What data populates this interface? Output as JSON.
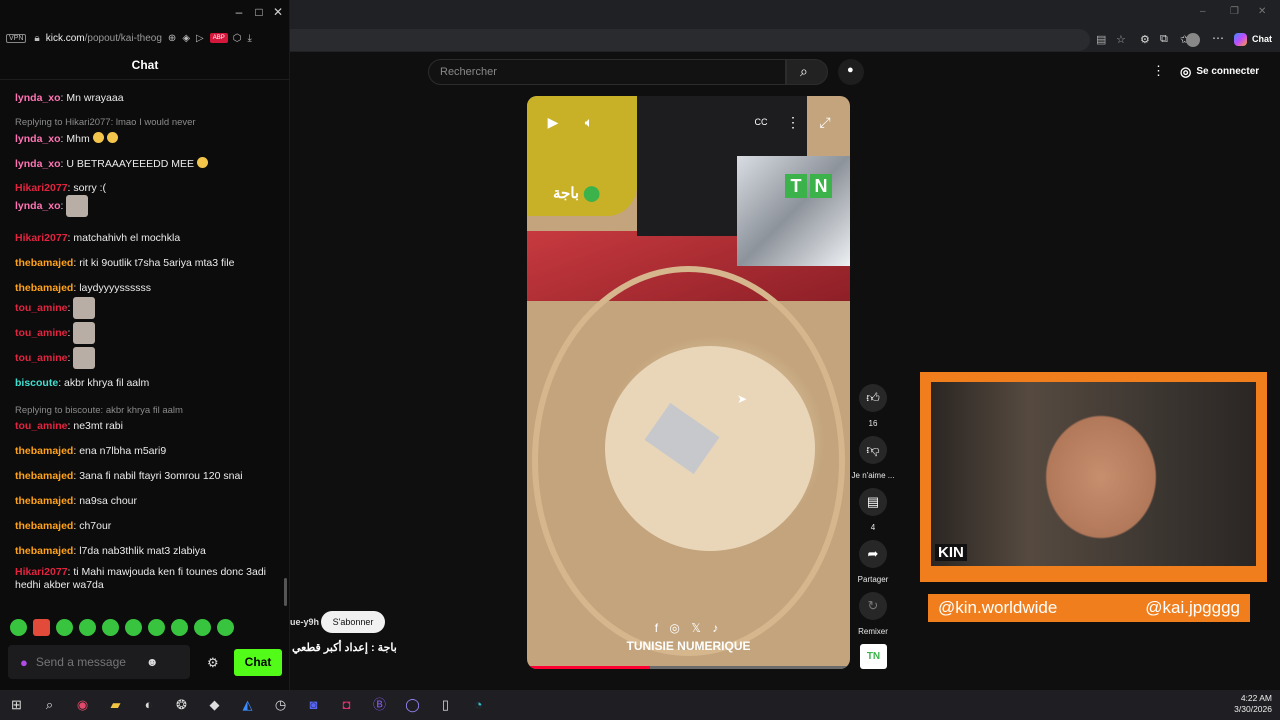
{
  "chat_window": {
    "url_host": "kick.com",
    "url_path": "/popout/kai-theog",
    "vpn_label": "VPN",
    "header_title": "Chat",
    "composer_placeholder": "Send a message",
    "send_label": "Chat"
  },
  "messages": [
    {
      "user": "lynda_xo",
      "text": "Mn wrayaaa",
      "color": "#ff74b3"
    },
    {
      "reply": "Replying to Hikari2077: lmao I would never"
    },
    {
      "user": "lynda_xo",
      "text": "Mhm",
      "color": "#ff74b3",
      "emojis": 2
    },
    {
      "user": "lynda_xo",
      "text": "U BETRAAAYEEEDD MEE",
      "color": "#ff74b3",
      "emojis": 1
    },
    {
      "user": "Hikari2077",
      "text": "sorry :(",
      "color": "#e2243f"
    },
    {
      "user": "lynda_xo",
      "text": "",
      "color": "#ff74b3",
      "emote": true
    },
    {
      "user": "Hikari2077",
      "text": "matchahivh el mochkla",
      "color": "#e2243f"
    },
    {
      "user": "thebamajed",
      "text": "rit ki 9outlik t7sha 5ariya mta3 file",
      "color": "#ffa21a"
    },
    {
      "user": "thebamajed",
      "text": "laydyyyyssssss",
      "color": "#ffa21a"
    },
    {
      "user": "tou_amine",
      "text": "",
      "color": "#e2243f",
      "emote": true
    },
    {
      "user": "tou_amine",
      "text": "",
      "color": "#e2243f",
      "emote": true
    },
    {
      "user": "tou_amine",
      "text": "",
      "color": "#e2243f",
      "emote": true
    },
    {
      "user": "biscoute",
      "text": "akbr khrya fil aalm",
      "color": "#40e0d0"
    },
    {
      "reply": "Replying to biscoute: akbr khrya fil aalm"
    },
    {
      "user": "tou_amine",
      "text": "ne3mt rabi",
      "color": "#e2243f"
    },
    {
      "user": "thebamajed",
      "text": "ena n7lbha m5ari9",
      "color": "#ffa21a"
    },
    {
      "user": "thebamajed",
      "text": "3ana fi nabil ftayri 3omrou 120 snai",
      "color": "#ffa21a"
    },
    {
      "user": "thebamajed",
      "text": "na9sa chour",
      "color": "#ffa21a"
    },
    {
      "user": "thebamajed",
      "text": "ch7our",
      "color": "#ffa21a"
    },
    {
      "user": "thebamajed",
      "text": "l7da nab3thlik mat3 zlabiya",
      "color": "#ffa21a"
    },
    {
      "user": "Hikari2077",
      "text": "ti Mahi mawjouda ken fi tounes donc 3adi hedhi akber wa7da",
      "color": "#e2243f"
    }
  ],
  "youtube": {
    "search_placeholder": "Rechercher",
    "signin_label": "Se connecter",
    "video": {
      "location_text": "باجة",
      "badge_letters": [
        "T",
        "N"
      ],
      "brand": "TUNISIE NUMERIQUE",
      "socials": "f ◎ 𝕏 ♪",
      "progress": 0.38
    },
    "actions": {
      "like_count": "16",
      "dislike_label": "Je n'aime ...",
      "comments_count": "4",
      "share_label": "Partager",
      "remix_label": "Remixer"
    },
    "channel_name": "ue-y9h",
    "subscribe_label": "S'abonner",
    "video_title": "باجة : إعداد أكبر قطعي"
  },
  "overlay": {
    "handle_left": "@kin.worldwide",
    "handle_right": "@kai.jpgggg",
    "accent": "#f07e1d"
  },
  "taskbar": {
    "time": "4:22 AM",
    "date": "3/30/2026"
  }
}
